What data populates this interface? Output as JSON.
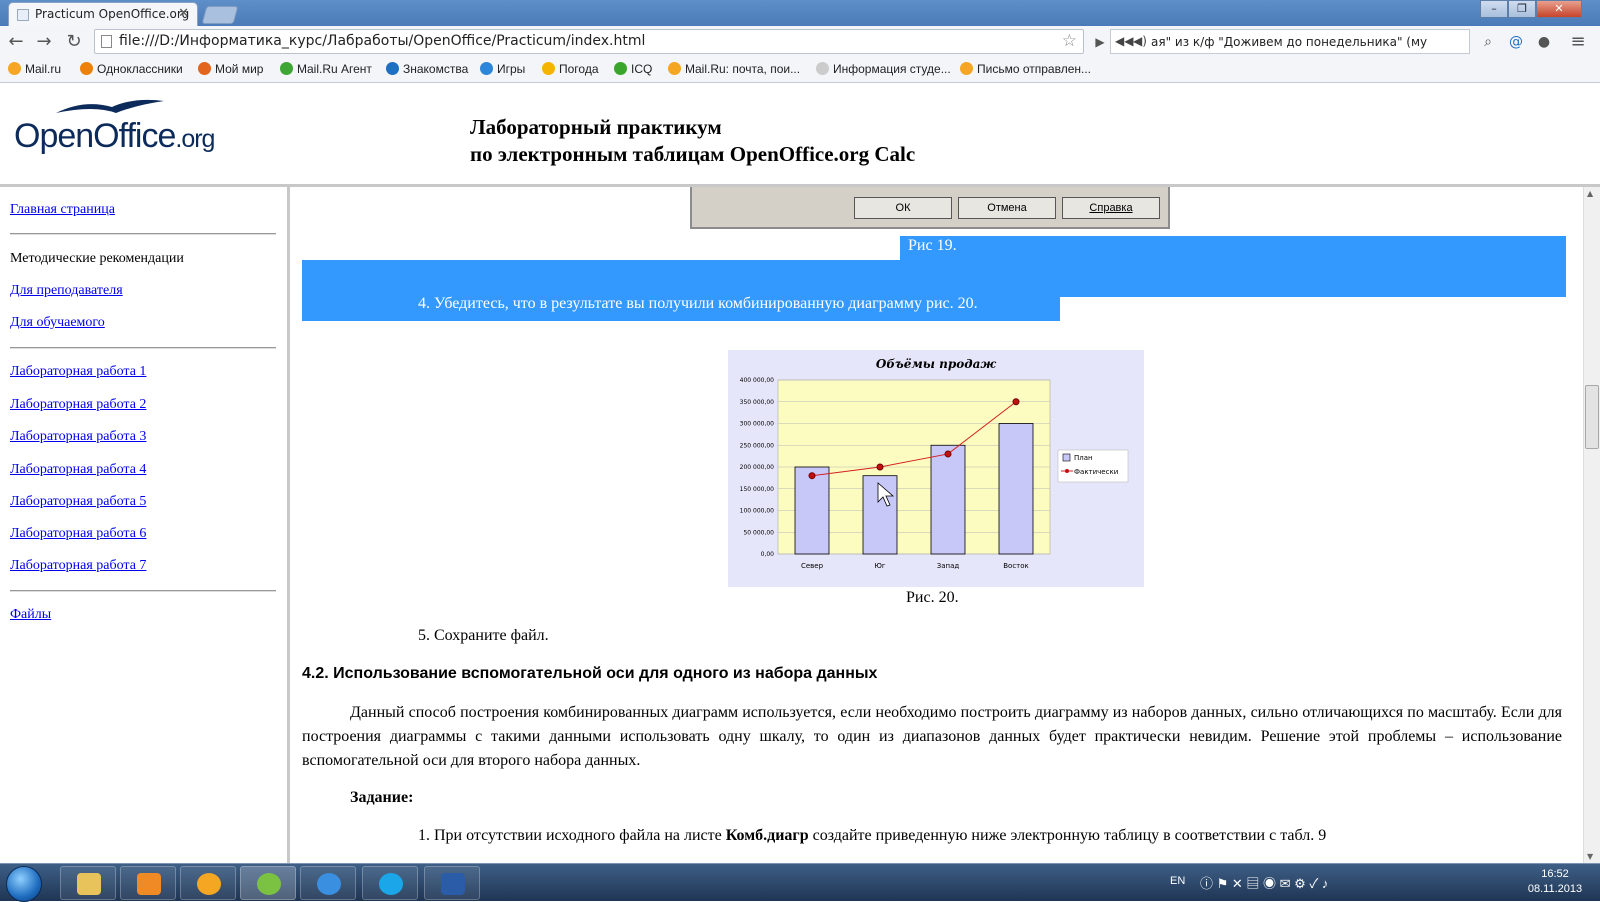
{
  "browser": {
    "tab_title": "Practicum OpenOffice.org",
    "url": "file:///D:/Информатика_курс/Лабработы/OpenOffice/Practicum/index.html",
    "player_text": "ая\" из к/ф \"Доживем до понедельника\" (му"
  },
  "bookmarks": [
    {
      "label": "Mail.ru",
      "color": "#f5a623"
    },
    {
      "label": "Одноклассники",
      "color": "#ee8208"
    },
    {
      "label": "Мой мир",
      "color": "#e2641d"
    },
    {
      "label": "Mail.Ru Агент",
      "color": "#3fa535"
    },
    {
      "label": "Знакомства",
      "color": "#1d6fc2"
    },
    {
      "label": "Игры",
      "color": "#2d86d8"
    },
    {
      "label": "Погода",
      "color": "#f4b400"
    },
    {
      "label": "ICQ",
      "color": "#3aa52b"
    },
    {
      "label": "Mail.Ru: почта, пои...",
      "color": "#f5a623"
    },
    {
      "label": "Информация студе...",
      "color": "#cccccc"
    },
    {
      "label": "Письмо отправлен...",
      "color": "#f5a623"
    }
  ],
  "header": {
    "logo_text": "OpenOffice",
    "logo_suffix": ".org",
    "title_line1": "Лабораторный практикум",
    "title_line2": "по электронным таблицам OpenOffice.org Calc"
  },
  "sidebar": {
    "home": "Главная страница",
    "methodic": "Методические рекомендации",
    "for_teacher": "Для преподавателя",
    "for_student": "Для обучаемого",
    "labs": [
      "Лабораторная работа 1",
      "Лабораторная работа 2",
      "Лабораторная работа 3",
      "Лабораторная работа 4",
      "Лабораторная работа 5",
      "Лабораторная работа 6",
      "Лабораторная работа 7"
    ],
    "files": "Файлы"
  },
  "dialog": {
    "ok": "ОК",
    "cancel": "Отмена",
    "help": "Справка"
  },
  "content": {
    "fig19": "Рис 19.",
    "item4": "4.  Убедитесь, что в результате вы получили комбинированную диаграмму рис. 20.",
    "fig20": "Рис. 20.",
    "item5": "5.  Сохраните файл.",
    "heading": "4.2. Использование вспомогательной оси для одного из набора данных",
    "paragraph": "Данный способ построения комбинированных диаграмм используется, если необходимо построить диаграмму из наборов данных, сильно отличающихся по масштабу. Если для построения диаграммы с такими данными использовать одну шкалу, то один из диапазонов данных будет практически невидим. Решение этой проблемы – использование вспомогательной оси для второго набора данных.",
    "task": "Задание:",
    "item1_a": "1.  При отсутствии исходного файла на листе ",
    "item1_b": "Комб.диагр",
    "item1_c": " создайте приведенную ниже электронную таблицу в соответствии с табл. 9"
  },
  "chart_data": {
    "type": "bar",
    "title": "Объёмы продаж",
    "categories": [
      "Север",
      "Юг",
      "Запад",
      "Восток"
    ],
    "ytick_labels": [
      "0,00",
      "50 000,00",
      "100 000,00",
      "150 000,00",
      "200 000,00",
      "250 000,00",
      "300 000,00",
      "350 000,00",
      "400 000,00"
    ],
    "ylim": [
      0,
      400000
    ],
    "series": [
      {
        "name": "План",
        "kind": "bar",
        "values": [
          200000,
          180000,
          250000,
          300000
        ],
        "color": "#c8c8f8"
      },
      {
        "name": "Фактически",
        "kind": "line",
        "values": [
          180000,
          200000,
          230000,
          350000
        ],
        "color": "#d42020"
      }
    ],
    "grid": true,
    "legend": "right",
    "plot_bg": "#fcfcc0"
  },
  "taskbar": {
    "lang": "EN",
    "time": "16:52",
    "date": "08.11.2013"
  }
}
